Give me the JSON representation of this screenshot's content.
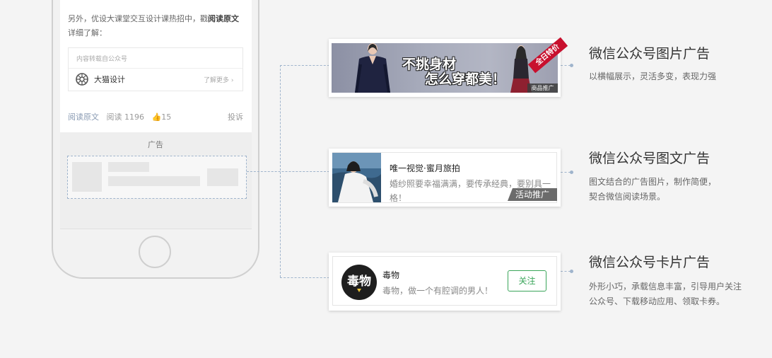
{
  "phone": {
    "intro_text": "另外，优设大课堂交互设计课热招中，戳",
    "intro_link": "阅读原文",
    "intro_text2": "详细了解：",
    "repost_label": "内容转载自公众号",
    "account_name": "大猫设计",
    "learn_more": "了解更多",
    "read_original": "阅读原文",
    "read_count": "阅读 1196",
    "like_count": "15",
    "complain": "投诉",
    "ad_label": "广告"
  },
  "ads": [
    {
      "title": "微信公众号图片广告",
      "desc": "以横幅展示，灵活多变，表现力强",
      "banner_line1": "不挑身材",
      "banner_line2": "怎么穿都美！",
      "corner_tag": "全日特价",
      "product_tag": "商品推广"
    },
    {
      "title": "微信公众号图文广告",
      "desc_line1": "图文结合的广告图片，制作简便，",
      "desc_line2": "契合微信阅读场景。",
      "feed_title": "唯一视觉·蜜月旅拍",
      "feed_desc": "婚纱照要幸福满满，要传承经典，要别具一格！",
      "promo_tag": "活动推广"
    },
    {
      "title": "微信公众号卡片广告",
      "desc_line1": "外形小巧，承载信息丰富，引导用户关注",
      "desc_line2": "公众号、下载移动应用、领取卡券。",
      "logo_text": "毒物",
      "card_name": "毒物",
      "card_desc": "毒物，做一个有腔调的男人！",
      "follow_label": "关注"
    }
  ],
  "colors": {
    "background": "#f4f4f4",
    "connector": "#9fb4cc",
    "follow_green": "#3aa55a",
    "link_blue": "#8a9bb3",
    "badge_red": "#c8102e"
  }
}
